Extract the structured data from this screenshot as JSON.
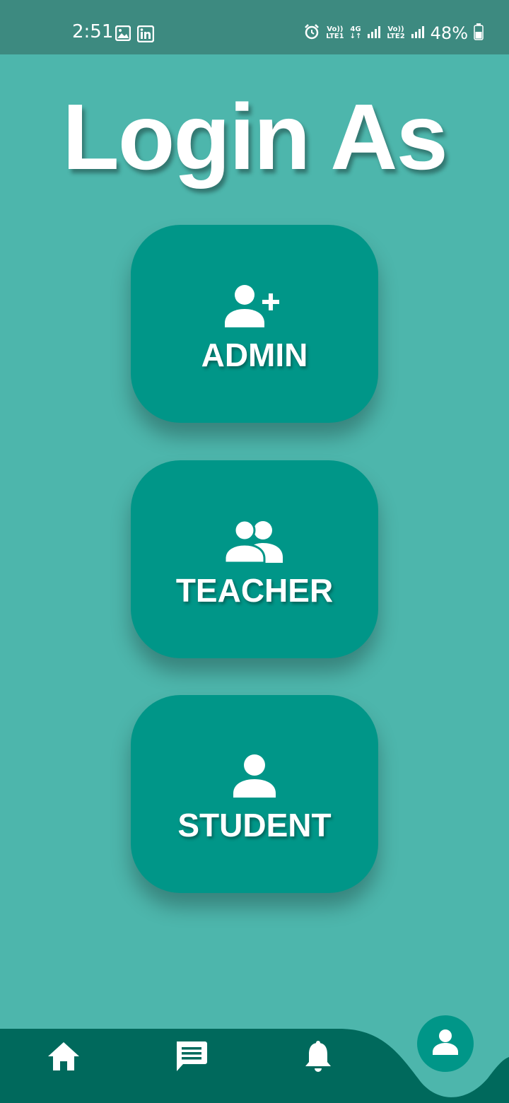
{
  "status_bar": {
    "time": "2:51",
    "sim1_top": "Vo))",
    "sim1_bottom": "LTE1",
    "net_type": "4G",
    "sim2_top": "Vo))",
    "sim2_bottom": "LTE2",
    "battery": "48%",
    "battery_level": 0.48
  },
  "page": {
    "title": "Login As"
  },
  "roles": [
    {
      "label": "ADMIN",
      "icon": "person-add-icon"
    },
    {
      "label": "TEACHER",
      "icon": "people-icon"
    },
    {
      "label": "STUDENT",
      "icon": "person-icon"
    }
  ],
  "bottom_nav": {
    "items": [
      "home-icon",
      "chat-icon",
      "bell-icon"
    ],
    "active": "person-icon"
  },
  "colors": {
    "background": "#4db6ac",
    "status_bar": "#3d8a80",
    "card": "#009688",
    "nav_bar": "#00695c"
  }
}
